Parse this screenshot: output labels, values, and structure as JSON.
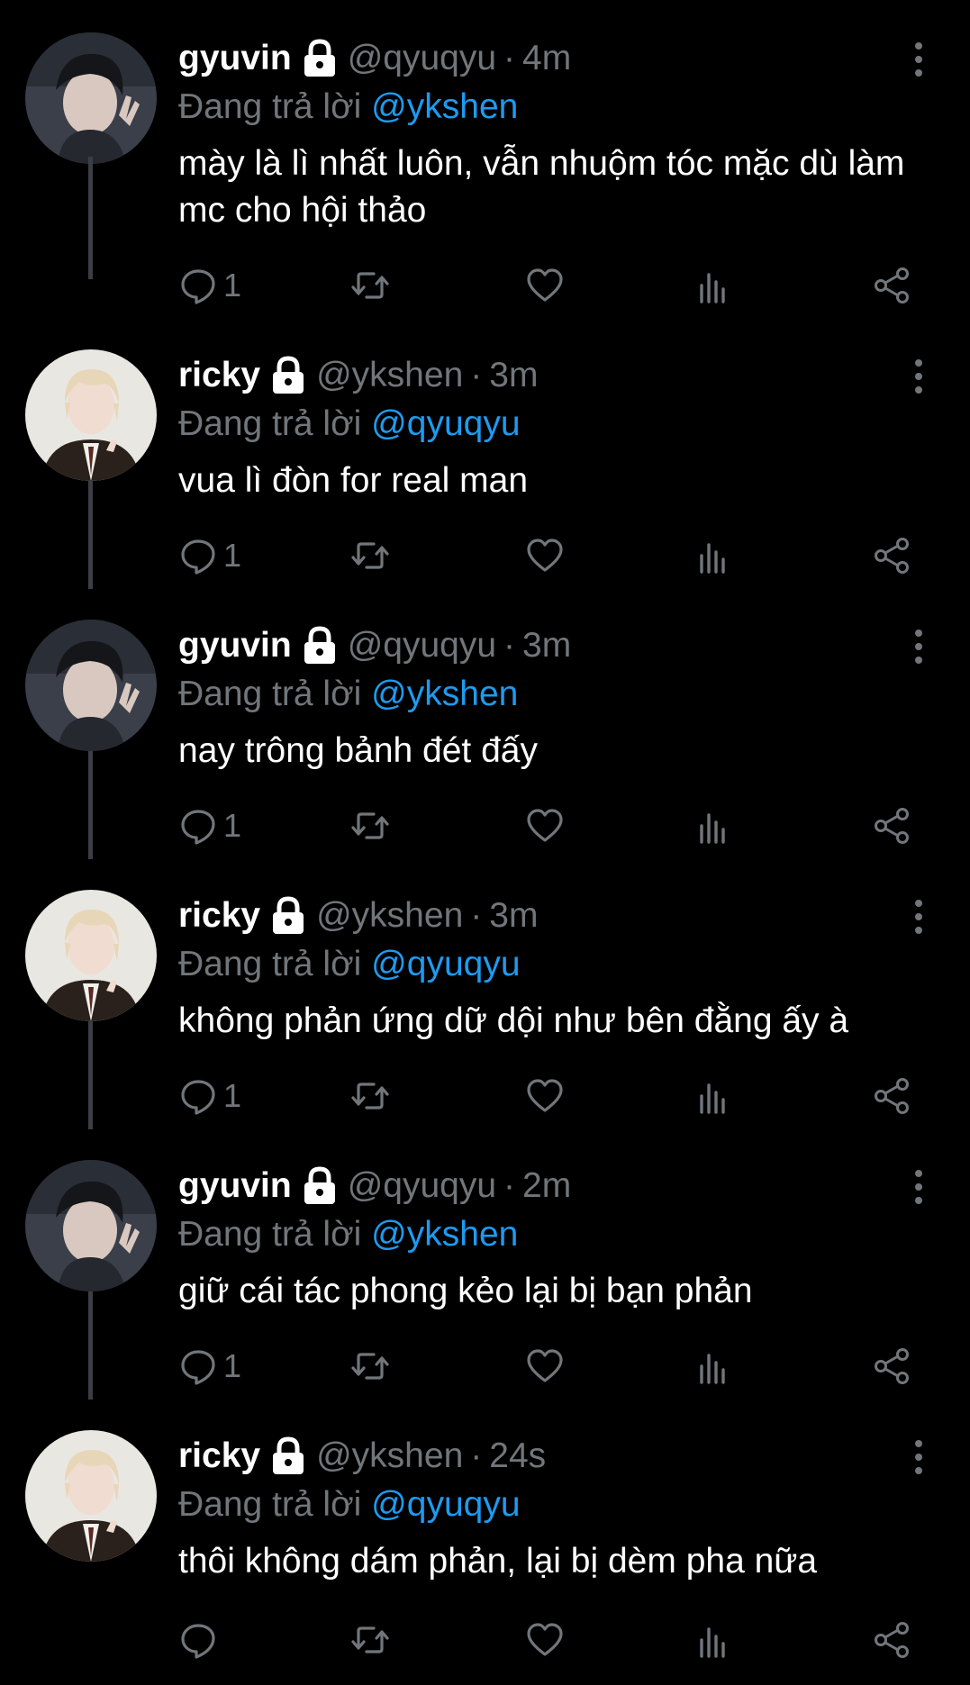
{
  "colors": {
    "background": "#000000",
    "text": "#ffffff",
    "muted": "#71767b",
    "mention": "#1d9bf0",
    "thread_line": "#3a3f44"
  },
  "tweets": [
    {
      "name": "gyuvin",
      "handle": "@qyuqyu",
      "separator": "·",
      "time": "4m",
      "reply_prefix": "Đang trả lời ",
      "reply_to": "@ykshen",
      "text": "mày là lì nhất luôn, vẫn nhuộm tóc mặc dù làm mc cho hội thảo",
      "reply_count": "1",
      "avatar_icon": "avatar-dark-hair-peace-sign",
      "lock_icon": "lock-icon"
    },
    {
      "name": "ricky",
      "handle": "@ykshen",
      "separator": "·",
      "time": "3m",
      "reply_prefix": "Đang trả lời ",
      "reply_to": "@qyuqyu",
      "text": "vua lì đòn for real man",
      "reply_count": "1",
      "avatar_icon": "avatar-blond-hair-suit",
      "lock_icon": "lock-icon"
    },
    {
      "name": "gyuvin",
      "handle": "@qyuqyu",
      "separator": "·",
      "time": "3m",
      "reply_prefix": "Đang trả lời ",
      "reply_to": "@ykshen",
      "text": "nay trông bảnh đét đấy",
      "reply_count": "1",
      "avatar_icon": "avatar-dark-hair-peace-sign",
      "lock_icon": "lock-icon"
    },
    {
      "name": "ricky",
      "handle": "@ykshen",
      "separator": "·",
      "time": "3m",
      "reply_prefix": "Đang trả lời ",
      "reply_to": "@qyuqyu",
      "text": "không phản ứng dữ dội như bên đằng ấy à",
      "reply_count": "1",
      "avatar_icon": "avatar-blond-hair-suit",
      "lock_icon": "lock-icon"
    },
    {
      "name": "gyuvin",
      "handle": "@qyuqyu",
      "separator": "·",
      "time": "2m",
      "reply_prefix": "Đang trả lời ",
      "reply_to": "@ykshen",
      "text": "giữ cái tác phong kẻo lại bị bạn phản",
      "reply_count": "1",
      "avatar_icon": "avatar-dark-hair-peace-sign",
      "lock_icon": "lock-icon"
    },
    {
      "name": "ricky",
      "handle": "@ykshen",
      "separator": "·",
      "time": "24s",
      "reply_prefix": "Đang trả lời ",
      "reply_to": "@qyuqyu",
      "text": "thôi không dám phản, lại bị dèm pha nữa",
      "reply_count": "",
      "avatar_icon": "avatar-blond-hair-suit",
      "lock_icon": "lock-icon"
    }
  ]
}
